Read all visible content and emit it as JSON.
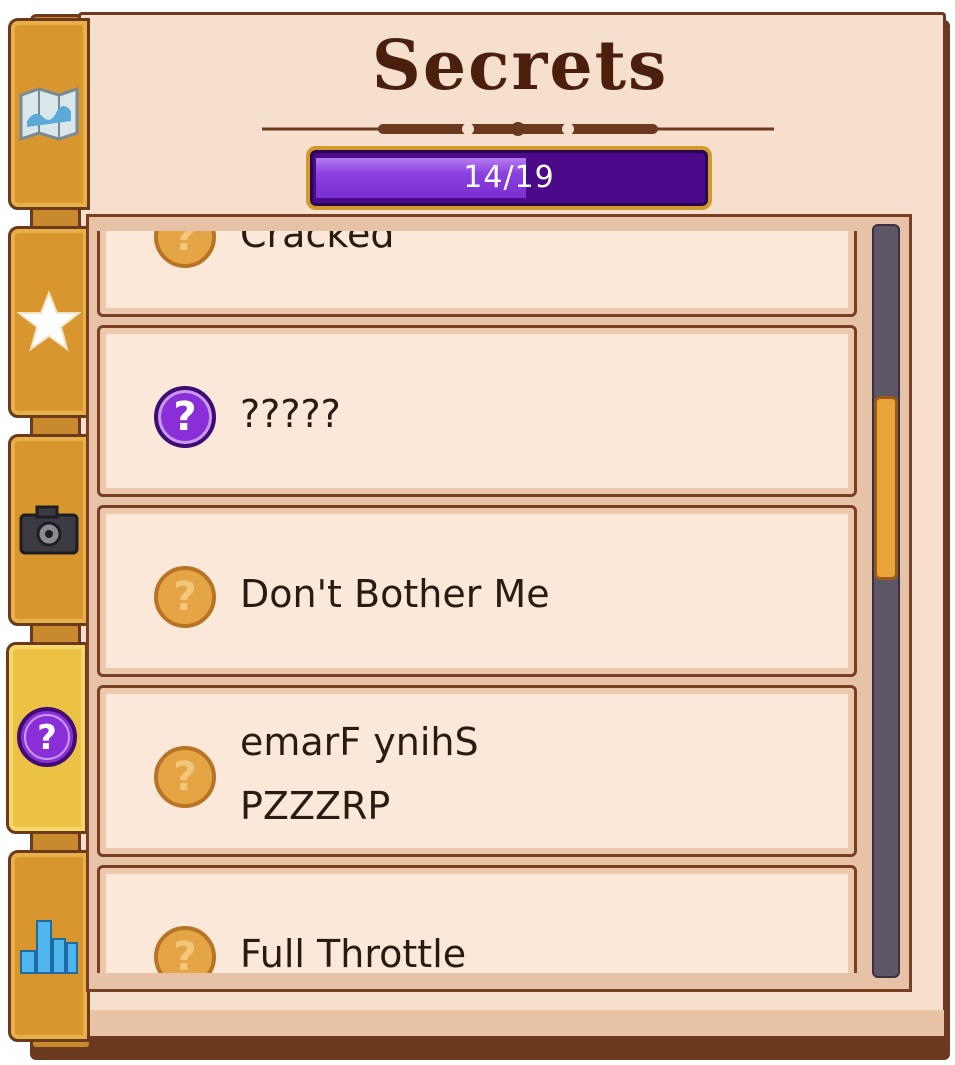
{
  "journal": {
    "title": "Secrets",
    "progress": {
      "completed": 14,
      "total": 19,
      "text": "14/19"
    }
  },
  "tabs": [
    {
      "icon": "map-icon",
      "active": false
    },
    {
      "icon": "star-icon",
      "active": false
    },
    {
      "icon": "camera-icon",
      "active": false
    },
    {
      "icon": "question-icon",
      "active": true
    },
    {
      "icon": "bar-chart-icon",
      "active": false
    }
  ],
  "secrets": [
    {
      "label": "Cracked",
      "icon": "question-locked-icon",
      "found": false
    },
    {
      "label": "?????",
      "icon": "question-secret-icon",
      "found": false
    },
    {
      "label": "Don't Bother Me",
      "icon": "question-locked-icon",
      "found": false
    },
    {
      "label": "emarF ynihS\nPZZZRP",
      "icon": "question-locked-icon",
      "found": false
    },
    {
      "label": "Full Throttle",
      "icon": "question-locked-icon",
      "found": false
    }
  ],
  "badge_glyph": "?",
  "colors": {
    "page": "#f6dfcc",
    "frame": "#6b3a1e",
    "progress_fill": "#8a3fe0",
    "progress_bg": "#4a0a8a",
    "locked_badge": "#e6a544",
    "secret_badge": "#8a2fd8",
    "tab": "#d8962e",
    "tab_active": "#ecc244"
  }
}
